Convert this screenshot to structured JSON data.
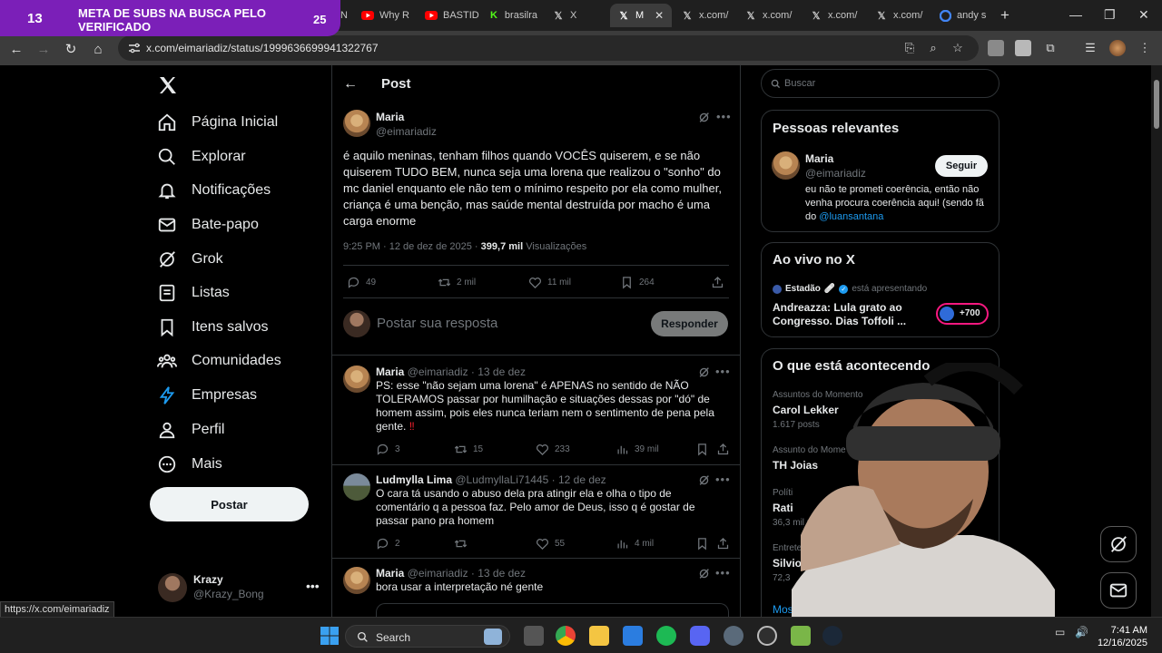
{
  "overlay": {
    "count": "13",
    "title": "META DE SUBS NA BUSCA PELO VERIFICADO",
    "number": "25"
  },
  "browser": {
    "tabs": [
      {
        "label": "ESPN",
        "favicon": "youtube-icon"
      },
      {
        "label": "Why R",
        "favicon": "youtube-icon"
      },
      {
        "label": "BASTID",
        "favicon": "youtube-icon"
      },
      {
        "label": "brasilra",
        "favicon": "kick-icon"
      },
      {
        "label": "X",
        "favicon": "x-icon"
      },
      {
        "label": "M",
        "favicon": "x-icon",
        "active": true
      },
      {
        "label": "x.com/",
        "favicon": "x-icon"
      },
      {
        "label": "x.com/",
        "favicon": "x-icon"
      },
      {
        "label": "x.com/",
        "favicon": "x-icon"
      },
      {
        "label": "x.com/",
        "favicon": "x-icon"
      },
      {
        "label": "andy s",
        "favicon": "google-icon"
      }
    ],
    "url": "x.com/eimariadiz/status/1999636699941322767",
    "status_url": "https://x.com/eimariadiz"
  },
  "nav": {
    "items": [
      {
        "label": "Página Inicial",
        "icon": "home-icon"
      },
      {
        "label": "Explorar",
        "icon": "search-icon"
      },
      {
        "label": "Notificações",
        "icon": "bell-icon"
      },
      {
        "label": "Bate-papo",
        "icon": "mail-icon"
      },
      {
        "label": "Grok",
        "icon": "grok-icon"
      },
      {
        "label": "Listas",
        "icon": "list-icon"
      },
      {
        "label": "Itens salvos",
        "icon": "bookmark-icon"
      },
      {
        "label": "Comunidades",
        "icon": "people-icon"
      },
      {
        "label": "Empresas",
        "icon": "lightning-icon"
      },
      {
        "label": "Perfil",
        "icon": "person-icon"
      },
      {
        "label": "Mais",
        "icon": "more-circle-icon"
      }
    ],
    "post_button": "Postar",
    "account": {
      "name": "Krazy",
      "handle": "@Krazy_Bong"
    }
  },
  "post": {
    "header": "Post",
    "author": "Maria",
    "handle": "@eimariadiz",
    "text": "é aquilo meninas, tenham filhos quando VOCÊS quiserem, e se não quiserem TUDO BEM, nunca seja uma lorena que realizou o \"sonho\" do mc daniel enquanto ele não tem o mínimo respeito por ela como mulher, criança é uma benção, mas saúde mental destruída por macho é uma carga enorme",
    "time": "9:25 PM · 12 de dez de 2025 · ",
    "views": "399,7 mil",
    "views_label": " Visualizações",
    "replies": "49",
    "reposts": "2 mil",
    "likes": "11 mil",
    "bookmarks": "264"
  },
  "reply_compose": {
    "placeholder": "Postar sua resposta",
    "button": "Responder"
  },
  "replies": [
    {
      "name": "Maria",
      "handle": "@eimariadiz",
      "date": " · 13 de dez",
      "text": "PS: esse \"não sejam uma lorena\" é APENAS no sentido de NÃO TOLERAMOS passar por humilhação e situações dessas por \"dó\" de homem assim, pois eles nunca teriam nem o sentimento de pena pela gente.",
      "emoji": "‼",
      "replies": "3",
      "reposts": "15",
      "likes": "233",
      "views": "39 mil"
    },
    {
      "name": "Ludmylla Lima",
      "handle": "@LudmyllaLi71445",
      "date": " · 12 de dez",
      "text": "O cara tá usando o abuso dela pra atingir ela e olha o tipo de comentário q a pessoa faz. Pelo amor de Deus, isso q é gostar de passar pano pra homem",
      "replies": "2",
      "reposts": "",
      "likes": "55",
      "views": "4 mil"
    },
    {
      "name": "Maria",
      "handle": "@eimariadiz",
      "date": " · 13 de dez",
      "text": "bora usar a interpretação né gente"
    }
  ],
  "sidebar": {
    "search_placeholder": "Buscar",
    "relevant": {
      "title": "Pessoas relevantes",
      "name": "Maria",
      "handle": "@eimariadiz",
      "follow": "Seguir",
      "bio": "eu não te prometi coerência, então não venha procura coerência aqui! (sendo fã do ",
      "bio_mention": "@luansantana"
    },
    "live": {
      "title": "Ao vivo no X",
      "host": "Estadão",
      "host_suffix": " está apresentando",
      "headline": "Andreazza: Lula grato ao Congresso. Dias Toffoli ...",
      "listeners": "+700"
    },
    "trends": {
      "title": "O que está acontecendo",
      "items": [
        {
          "category": "Assuntos do Momento",
          "name": "Carol Lekker",
          "count": "1.617 posts"
        },
        {
          "category": "Assunto do Mome",
          "name": "TH Joias",
          "count": ""
        },
        {
          "category": "Políti",
          "name": "Rati",
          "count": "36,3 mil posts"
        },
        {
          "category": "Entretenime",
          "name": "Silvio Sa",
          "count": "72,3"
        }
      ],
      "show_more": "Mos"
    }
  },
  "taskbar": {
    "search": "Search",
    "time": "7:41 AM",
    "date": "12/16/2025"
  },
  "colors": {
    "accent": "#1d9bf0",
    "overlay": "#7b1fb8",
    "background": "#000000"
  }
}
